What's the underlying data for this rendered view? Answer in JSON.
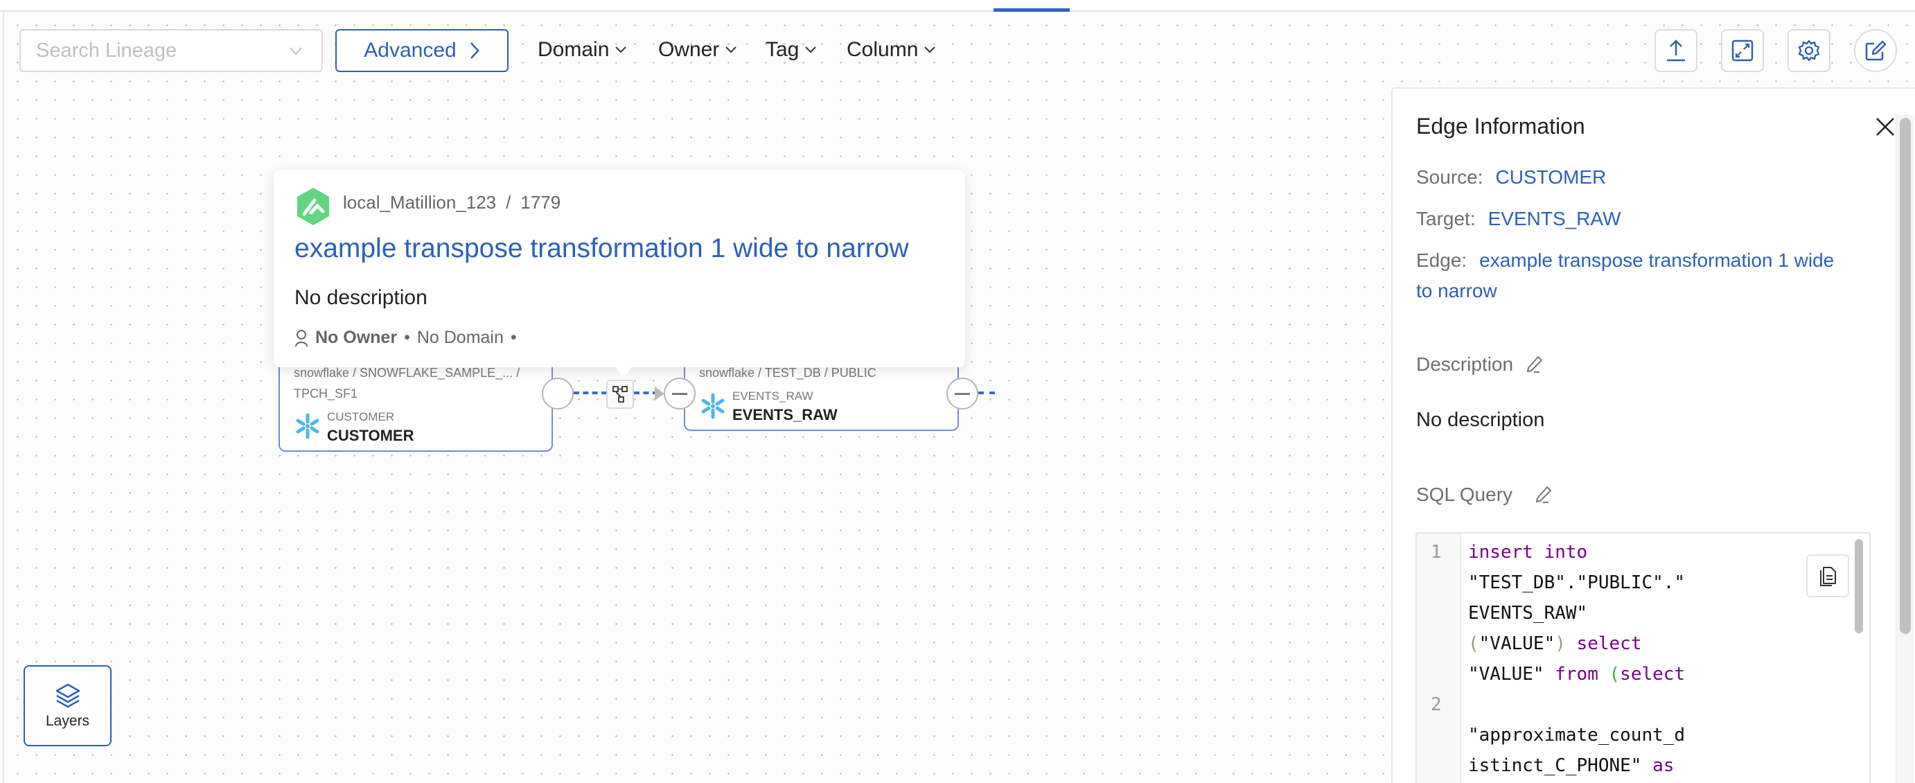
{
  "toolbar": {
    "search_placeholder": "Search Lineage",
    "advanced_label": "Advanced",
    "filters": [
      {
        "label": "Domain"
      },
      {
        "label": "Owner"
      },
      {
        "label": "Tag"
      },
      {
        "label": "Column"
      }
    ],
    "actions": [
      {
        "icon": "upload-icon",
        "label": "Export"
      },
      {
        "icon": "fullscreen-icon",
        "label": "Fullscreen"
      },
      {
        "icon": "gear-icon",
        "label": "Settings"
      },
      {
        "icon": "edit-icon",
        "label": "Edit lineage"
      }
    ],
    "accent_color": "#2d5fb8"
  },
  "popover": {
    "service": "local_Matillion_123",
    "separator": "/",
    "id": "1779",
    "title": "example transpose transformation 1 wide to narrow",
    "description": "No description",
    "owner": "No Owner",
    "domain": "No Domain",
    "bullet": "•"
  },
  "nodes": [
    {
      "path": "snowflake / SNOWFLAKE_SAMPLE_... /",
      "path2": "TPCH_SF1",
      "type_label": "CUSTOMER",
      "name": "CUSTOMER",
      "icon": "snowflake-icon"
    },
    {
      "path": "snowflake / TEST_DB / PUBLIC",
      "type_label": "EVENTS_RAW",
      "name": "EVENTS_RAW",
      "icon": "snowflake-icon"
    }
  ],
  "layers": {
    "label": "Layers"
  },
  "panel": {
    "title": "Edge Information",
    "source_label": "Source:",
    "source_value": "CUSTOMER",
    "target_label": "Target:",
    "target_value": "EVENTS_RAW",
    "edge_label": "Edge:",
    "edge_value": "example transpose transformation 1 wide to narrow",
    "description_label": "Description",
    "description_value": "No description",
    "sql_label": "SQL Query",
    "sql": {
      "line_numbers": [
        "1",
        "2"
      ],
      "lines": [
        {
          "kw1": "insert",
          "kw2": "into"
        },
        {
          "text": "\"TEST_DB\".\"PUBLIC\".\""
        },
        {
          "text": "EVENTS_RAW\""
        },
        {
          "p_open": "(",
          "text": "\"VALUE\"",
          "p_close": ")",
          "kw": "select"
        },
        {
          "text": "\"VALUE\"",
          "kw": "from",
          "p_open": "(",
          "kw2": "select"
        },
        {
          "text": ""
        },
        {
          "text": "\"approximate_count_d"
        },
        {
          "text": "istinct_C_PHONE\"",
          "kw": "as"
        }
      ]
    }
  }
}
